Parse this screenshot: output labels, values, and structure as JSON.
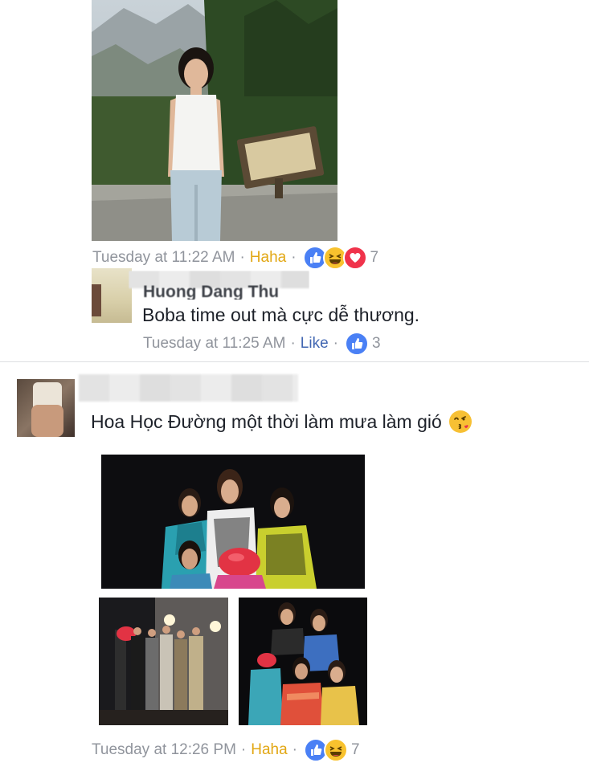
{
  "post1": {
    "timestamp": "Tuesday at 11:22 AM",
    "reaction_label": "Haha",
    "reaction_count": "7",
    "reactions": [
      "like-icon",
      "haha-icon",
      "love-icon"
    ]
  },
  "reply": {
    "author": "Huong Dang Thu",
    "text": "Boba time out mà cực dễ thương.",
    "timestamp": "Tuesday at 11:25 AM",
    "action_label": "Like",
    "like_count": "3"
  },
  "comment2": {
    "text": "Hoa Học Đường một thời làm mưa làm gió",
    "emoji": "😘",
    "timestamp": "Tuesday at 12:26 PM",
    "reaction_label": "Haha",
    "reaction_count": "7",
    "reactions": [
      "like-icon",
      "haha-icon"
    ]
  },
  "separator": "·",
  "colors": {
    "meta": "#90949c",
    "haha": "#e2a714",
    "like_link": "#4267b2",
    "text": "#1d2129"
  }
}
